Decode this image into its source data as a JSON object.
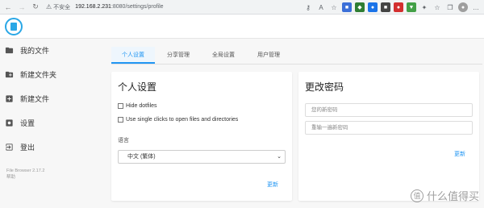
{
  "browser": {
    "security_text": "不安全",
    "url_host": "192.168.2.231",
    "url_path": ":8080/settings/profile"
  },
  "sidebar": {
    "items": [
      {
        "label": "我的文件",
        "icon": "folder-icon"
      },
      {
        "label": "新建文件夹",
        "icon": "new-folder-icon"
      },
      {
        "label": "新建文件",
        "icon": "new-file-icon"
      },
      {
        "label": "设置",
        "icon": "settings-icon"
      },
      {
        "label": "登出",
        "icon": "logout-icon"
      }
    ],
    "version": "File Browser 2.17.2",
    "help": "帮助"
  },
  "tabs": [
    {
      "label": "个人设置",
      "active": true
    },
    {
      "label": "分享管理",
      "active": false
    },
    {
      "label": "全局设置",
      "active": false
    },
    {
      "label": "用户管理",
      "active": false
    }
  ],
  "personal": {
    "title": "个人设置",
    "hide_dotfiles": "Hide dotfiles",
    "single_click": "Use single clicks to open files and directories",
    "language_label": "语言",
    "language_value": "中文 (繁体)",
    "update": "更新"
  },
  "password": {
    "title": "更改密码",
    "new_password_placeholder": "您的新密码",
    "confirm_placeholder": "重输一遍新密码",
    "update": "更新"
  },
  "watermark": {
    "badge": "值",
    "text": "什么值得买"
  },
  "colors": {
    "accent": "#2196f3",
    "logo": "#2aa7e6"
  }
}
